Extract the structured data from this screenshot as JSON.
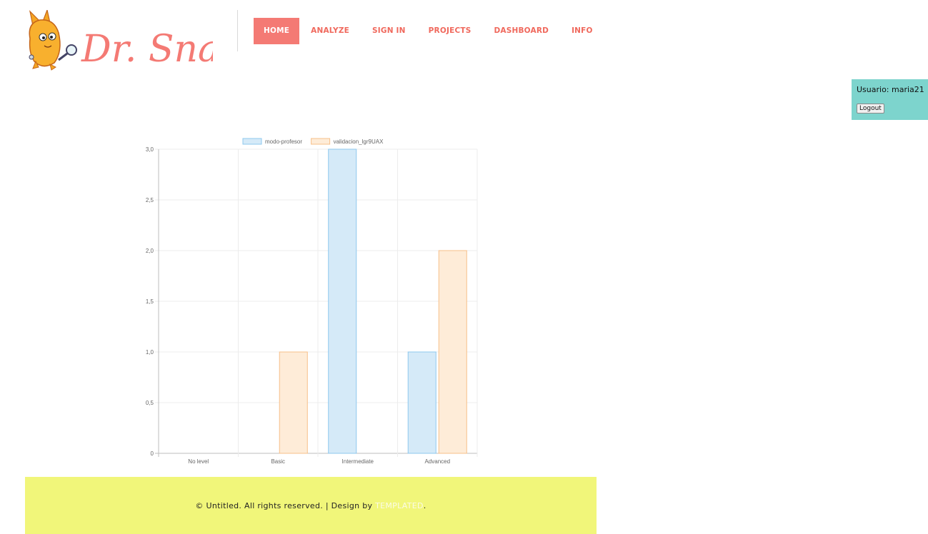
{
  "header": {
    "logo_text": "Dr. Snap!",
    "nav": [
      {
        "label": "HOME",
        "active": true
      },
      {
        "label": "ANALYZE",
        "active": false
      },
      {
        "label": "SIGN IN",
        "active": false
      },
      {
        "label": "PROJECTS",
        "active": false
      },
      {
        "label": "DASHBOARD",
        "active": false
      },
      {
        "label": "INFO",
        "active": false
      }
    ]
  },
  "user": {
    "label": "Usuario: maria21",
    "logout_label": "Logout"
  },
  "chart_data": {
    "type": "bar",
    "categories": [
      "No level",
      "Basic",
      "Intermediate",
      "Advanced"
    ],
    "series": [
      {
        "name": "modo-profesor",
        "values": [
          0,
          0,
          3,
          1
        ],
        "color": "#d5eaf8",
        "border": "#8ec8ee"
      },
      {
        "name": "validacion_lgr9UAX",
        "values": [
          0,
          1,
          0,
          2
        ],
        "color": "#feecd8",
        "border": "#f7c08a"
      }
    ],
    "ylim": [
      0,
      3
    ],
    "yticks": [
      "0",
      "0,5",
      "1,0",
      "1,5",
      "2,0",
      "2,5",
      "3,0"
    ],
    "legend": "top",
    "grid": true
  },
  "footer": {
    "text": "© Untitled. All rights reserved. | Design by ",
    "link": "TEMPLATED",
    "end": "."
  },
  "colors": {
    "accent": "#f47a74",
    "user_box": "#7dd4cd",
    "footer_bg": "#f1f67a"
  }
}
